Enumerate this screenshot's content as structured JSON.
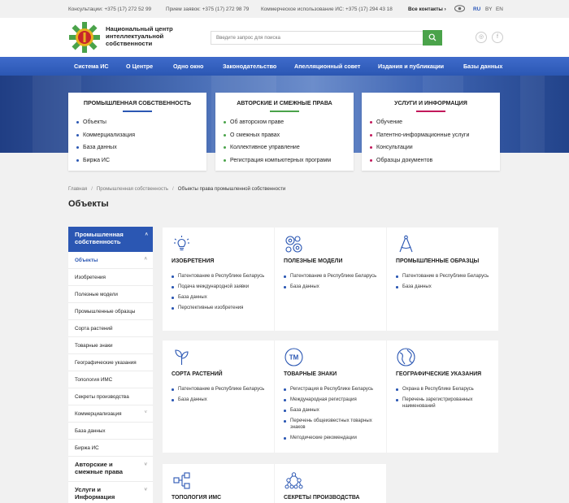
{
  "topbar": {
    "consult": "Консультации: +375 (17) 272 52 99",
    "intake": "Прием заявок: +375 (17) 272 98 79",
    "commercial": "Коммерческое использование ИС: +375 (17) 294 43 18",
    "contacts": "Все контакты",
    "contacts_arrow": "›",
    "languages": [
      "RU",
      "BY",
      "EN"
    ]
  },
  "header": {
    "brand_line1": "Национальный центр",
    "brand_line2": "интеллектуальной",
    "brand_line3": "собственности",
    "search_placeholder": "Введите запрос для поиска",
    "social": [
      "◎",
      "f"
    ]
  },
  "nav": [
    "Система ИС",
    "О Центре",
    "Одно окно",
    "Законодательство",
    "Апелляционный совет",
    "Издания и публикации",
    "Базы данных"
  ],
  "categories": [
    {
      "title": "ПРОМЫШЛЕННАЯ СОБСТВЕННОСТЬ",
      "color": "#2b57b3",
      "items": [
        "Объекты",
        "Коммерциализация",
        "База данных",
        "Биржа ИС"
      ]
    },
    {
      "title": "АВТОРСКИЕ И СМЕЖНЫЕ ПРАВА",
      "color": "#4aa34a",
      "items": [
        "Об авторском праве",
        "О смежных правах",
        "Коллективное управление",
        "Регистрация компьютерных программ"
      ]
    },
    {
      "title": "УСЛУГИ И ИНФОРМАЦИЯ",
      "color": "#c2185b",
      "items": [
        "Обучение",
        "Патентно-информационные услуги",
        "Консультации",
        "Образцы документов"
      ]
    }
  ],
  "breadcrumbs": [
    "Главная",
    "Промышленная собственность",
    "Объекты права промышленной собственности"
  ],
  "breadcrumb_sep": "/",
  "page_title": "Объекты",
  "sidebar": {
    "head_line1": "Промышленная",
    "head_line2": "собственность",
    "chev_up": "˄",
    "chev_down": "˅",
    "items": [
      "Объекты",
      "Изобретения",
      "Полезные модели",
      "Промышленные образцы",
      "Сорта растений",
      "Товарные знаки",
      "Географические указания",
      "Топология ИМС",
      "Секреты производства",
      "Коммерциализация",
      "База данных",
      "Биржа ИС"
    ],
    "sections": [
      {
        "line1": "Авторские и",
        "line2": "смежные права"
      },
      {
        "line1": "Услуги и",
        "line2": "Информация"
      }
    ]
  },
  "cards": [
    {
      "icon": "lightbulb-icon",
      "title": "ИЗОБРЕТЕНИЯ",
      "items": [
        "Патентование в Республике Беларусь",
        "Подача международной заявки",
        "База данных",
        "Перспективные изобретения"
      ]
    },
    {
      "icon": "gears-icon",
      "title": "ПОЛЕЗНЫЕ МОДЕЛИ",
      "items": [
        "Патентование в Республике Беларусь",
        "База данных"
      ]
    },
    {
      "icon": "compass-icon",
      "title": "ПРОМЫШЛЕННЫЕ ОБРАЗЦЫ",
      "items": [
        "Патентование в Республике Беларусь",
        "База данных"
      ]
    },
    {
      "icon": "sprout-icon",
      "title": "СОРТА РАСТЕНИЙ",
      "items": [
        "Патентование в Республике Беларусь",
        "База данных"
      ]
    },
    {
      "icon": "trademark-icon",
      "title": "ТОВАРНЫЕ ЗНАКИ",
      "items": [
        "Регистрация в Республике Беларусь",
        "Международная регистрация",
        "База данных",
        "Перечень общеизвестных товарных знаков",
        "Методические рекомендации"
      ]
    },
    {
      "icon": "globe-icon",
      "title": "ГЕОГРАФИЧЕСКИЕ УКАЗАНИЯ",
      "items": [
        "Охрана в Республике Беларусь",
        "Перечень зарегистрированных наименований"
      ]
    },
    {
      "icon": "chip-icon",
      "title": "ТОПОЛОГИЯ ИМС",
      "items": []
    },
    {
      "icon": "molecule-icon",
      "title": "СЕКРЕТЫ ПРОИЗВОДСТВА",
      "items": []
    }
  ],
  "tm_glyph": "TM"
}
